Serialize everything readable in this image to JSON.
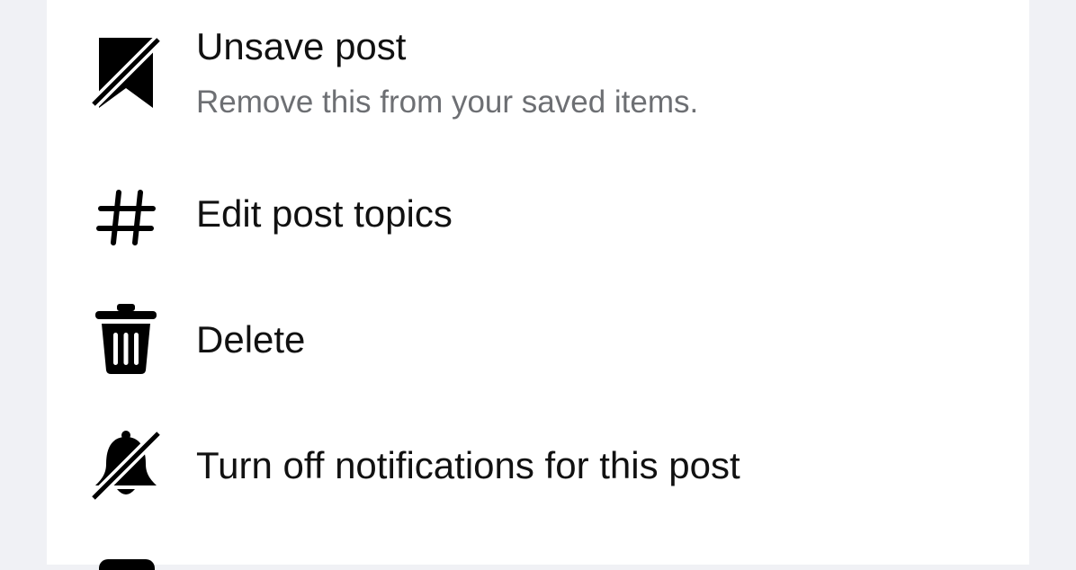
{
  "menu": {
    "items": [
      {
        "icon": "bookmark-slash-icon",
        "title": "Unsave post",
        "subtitle": "Remove this from your saved items."
      },
      {
        "icon": "hashtag-icon",
        "title": "Edit post topics"
      },
      {
        "icon": "trash-icon",
        "title": "Delete"
      },
      {
        "icon": "bell-slash-icon",
        "title": "Turn off notifications for this post"
      }
    ]
  },
  "colors": {
    "background": "#f0f1f5",
    "sheet": "#ffffff",
    "text_primary": "#111111",
    "text_secondary": "#6d6f73",
    "icon": "#000000"
  }
}
